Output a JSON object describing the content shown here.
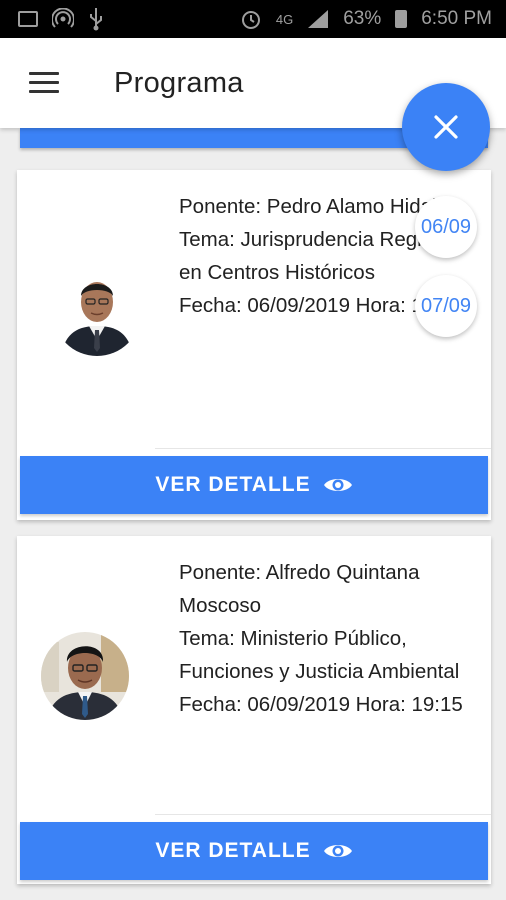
{
  "status_bar": {
    "network": "4G",
    "battery": "63%",
    "time": "6:50 PM"
  },
  "app_bar": {
    "title": "Programa"
  },
  "date_chips": [
    "06/09",
    "07/09"
  ],
  "sessions": [
    {
      "speaker": "Ponente: Pedro Alamo Hidalgo",
      "topic": "Tema: Jurisprudencia Registral en Centros Históricos",
      "datetime": "Fecha: 06/09/2019 Hora: 17:55",
      "button_label": "VER DETALLE"
    },
    {
      "speaker": "Ponente: Alfredo Quintana Moscoso",
      "topic": "Tema: Ministerio Público, Funciones y Justicia Ambiental",
      "datetime": "Fecha: 06/09/2019 Hora: 19:15",
      "button_label": "VER DETALLE"
    }
  ],
  "colors": {
    "primary": "#3b82f6",
    "chip_text": "#4285f4",
    "status_bar": "#000000",
    "background": "#eeeeee"
  }
}
